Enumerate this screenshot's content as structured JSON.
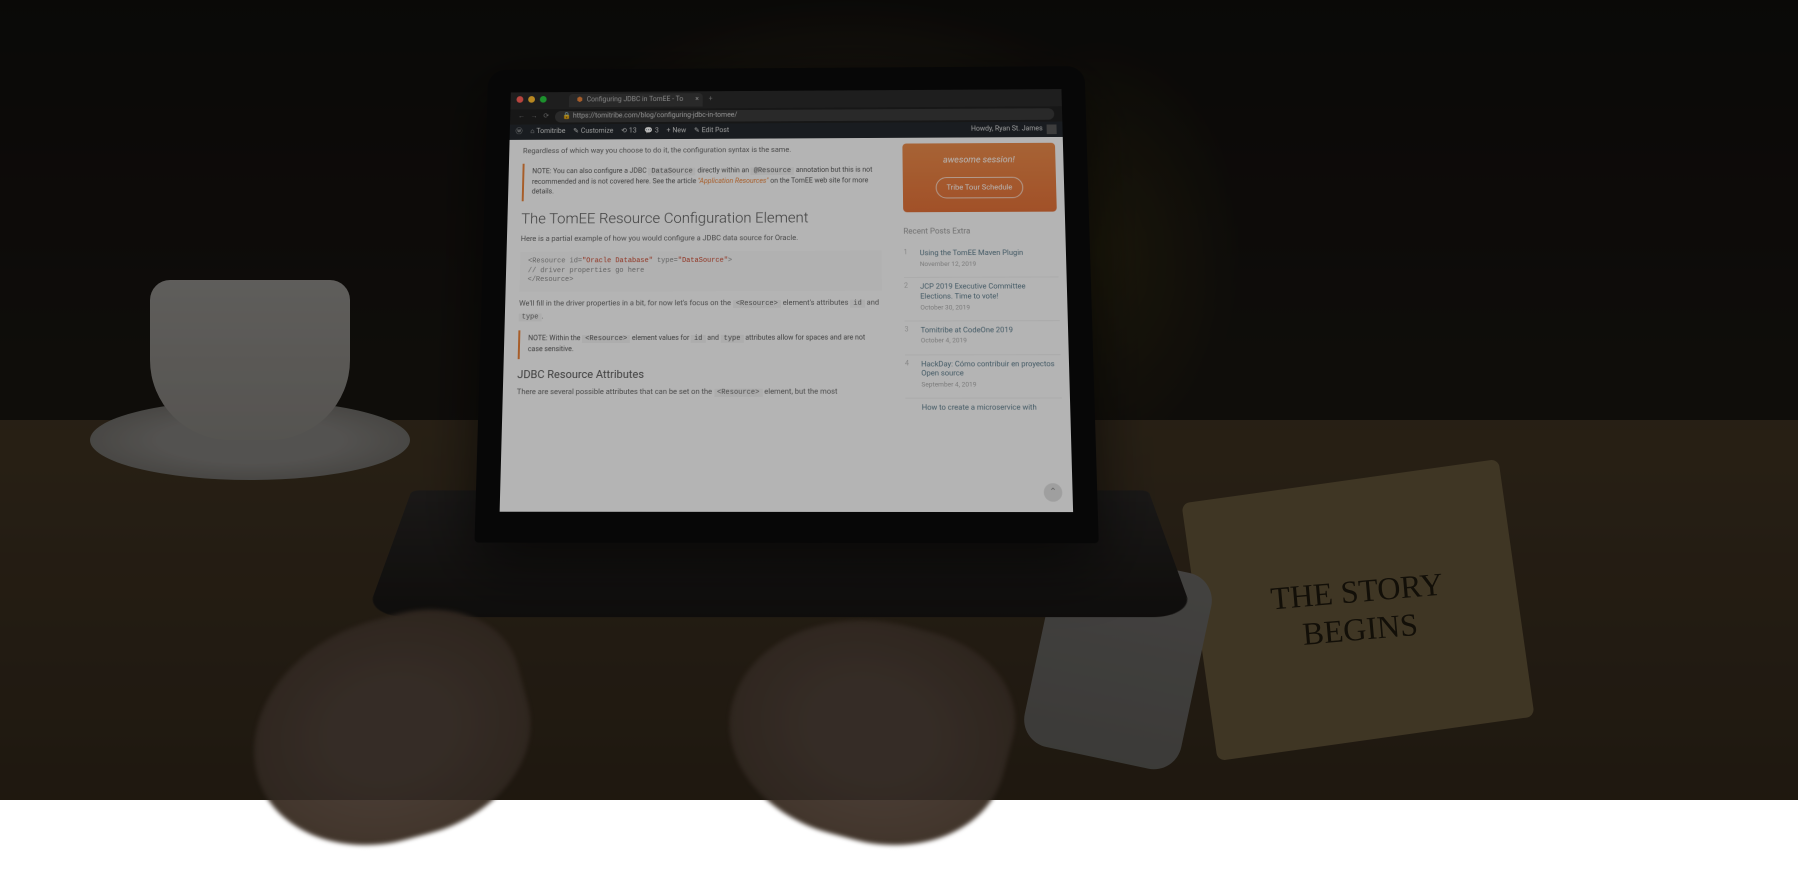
{
  "browser": {
    "tab_title": "Configuring JDBC in TomEE - To",
    "url": "https://tomitribe.com/blog/configuring-jdbc-in-tomee/"
  },
  "wp_admin": {
    "site_name": "Tomitribe",
    "customize": "Customize",
    "updates_count": "13",
    "comments_count": "3",
    "new_label": "New",
    "edit_post": "Edit Post",
    "howdy": "Howdy, Ryan St. James"
  },
  "article": {
    "intro_line": "Regardless of which way you choose to do it, the configuration syntax is the same.",
    "note1_prefix": "NOTE: You can also configure a JDBC",
    "note1_code1": "DataSource",
    "note1_mid": "directly within an",
    "note1_code2": "@Resource",
    "note1_body": "annotation but this is not recommended and is not covered here. See the article",
    "note1_link": "\"Application Resources\"",
    "note1_suffix": "on the TomEE web site for more details.",
    "h2": "The TomEE Resource Configuration Element",
    "h2_sub": "Here is a partial example of how you would configure a JDBC data source for Oracle.",
    "code_line1a": "<Resource id=",
    "code_line1b": "\"Oracle Database\"",
    "code_line1c": " type=",
    "code_line1d": "\"DataSource\"",
    "code_line1e": ">",
    "code_line2": "  // driver properties go here",
    "code_line3": "</Resource>",
    "para2a": "We'll fill in the driver properties in a bit, for now let's focus on the",
    "para2_code1": "<Resource>",
    "para2b": "element's attributes",
    "para2_code2": "id",
    "para2c": "and",
    "para2_code3": "type",
    "para2d": ".",
    "note2_prefix": "NOTE: Within the",
    "note2_code1": "<Resource>",
    "note2_mid": "element values for",
    "note2_code2": "id",
    "note2_and": "and",
    "note2_code3": "type",
    "note2_body": "attributes allow for spaces and are not case sensitive.",
    "h3": "JDBC Resource Attributes",
    "para3a": "There are several possible attributes that can be set on the",
    "para3_code": "<Resource>",
    "para3b": "element, but the most"
  },
  "promo": {
    "title": "awesome session!",
    "button": "Tribe Tour Schedule"
  },
  "sidebar": {
    "widget_title": "Recent Posts Extra",
    "posts": [
      {
        "n": "1",
        "title": "Using the TomEE Maven Plugin",
        "date": "November 12, 2019"
      },
      {
        "n": "2",
        "title": "JCP 2019 Executive Committee Elections. Time to vote!",
        "date": "October 30, 2019"
      },
      {
        "n": "3",
        "title": "Tomitribe at CodeOne 2019",
        "date": "October 4, 2019"
      },
      {
        "n": "4",
        "title": "HackDay: Cómo contribuir en proyectos Open source",
        "date": "September 4, 2019"
      },
      {
        "n": "",
        "title": "How to create a microservice with",
        "date": ""
      }
    ]
  },
  "notebook": {
    "line1": "THE STORY",
    "line2": "BEGINS"
  }
}
